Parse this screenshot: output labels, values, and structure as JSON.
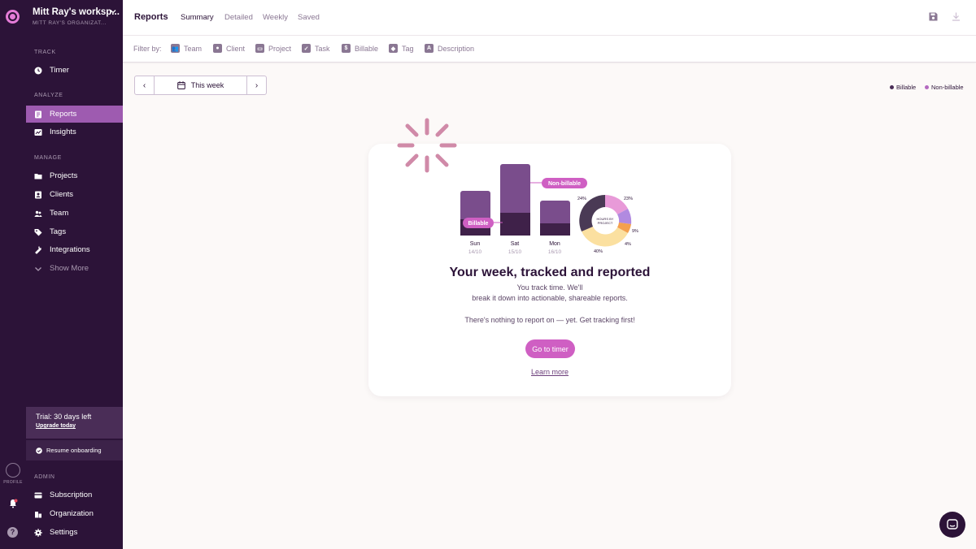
{
  "workspace": {
    "name": "Mitt Ray's worksp...",
    "org": "MITT RAY'S ORGANIZAT..."
  },
  "sidebar": {
    "sections": {
      "track": "TRACK",
      "analyze": "ANALYZE",
      "manage": "MANAGE",
      "admin": "ADMIN"
    },
    "timer": "Timer",
    "reports": "Reports",
    "insights": "Insights",
    "projects": "Projects",
    "clients": "Clients",
    "team": "Team",
    "tags": "Tags",
    "integrations": "Integrations",
    "show_more": "Show More",
    "trial_text": "Trial: 30 days left",
    "upgrade_link": "Upgrade today",
    "resume_onboarding": "Resume onboarding",
    "subscription": "Subscription",
    "organization": "Organization",
    "settings": "Settings"
  },
  "rail": {
    "profile_label": "PROFILE",
    "help": "?"
  },
  "header": {
    "title": "Reports",
    "tabs": [
      "Summary",
      "Detailed",
      "Weekly",
      "Saved"
    ]
  },
  "filters": {
    "label": "Filter by:",
    "items": [
      "Team",
      "Client",
      "Project",
      "Task",
      "Billable",
      "Tag",
      "Description"
    ]
  },
  "datepicker": {
    "prev": "‹",
    "label": "This week",
    "next": "›"
  },
  "legend": {
    "billable": "Billable",
    "non_billable": "Non-billable"
  },
  "colors": {
    "billable": "#4a2d57",
    "non_billable": "#b469c0",
    "accent": "#cf5fc3"
  },
  "illustration": {
    "days": [
      {
        "day": "Sun",
        "date": "14/10"
      },
      {
        "day": "Sat",
        "date": "15/10"
      },
      {
        "day": "Mon",
        "date": "16/10"
      }
    ],
    "tag_billable": "Billable",
    "tag_non_billable": "Non-billable",
    "donut_label_1": "HOURS BY",
    "donut_label_2": "PROJECT",
    "pct_1": "24%",
    "pct_2": "23%",
    "pct_3": "9%",
    "pct_4": "4%",
    "pct_5": "40%"
  },
  "empty": {
    "title": "Your week, tracked and reported",
    "line1": "You track time. We'll",
    "line2": "break it down into actionable, shareable reports.",
    "line3": "There's nothing to report on — yet. Get tracking first!",
    "button": "Go to timer",
    "learn_more": "Learn more"
  }
}
